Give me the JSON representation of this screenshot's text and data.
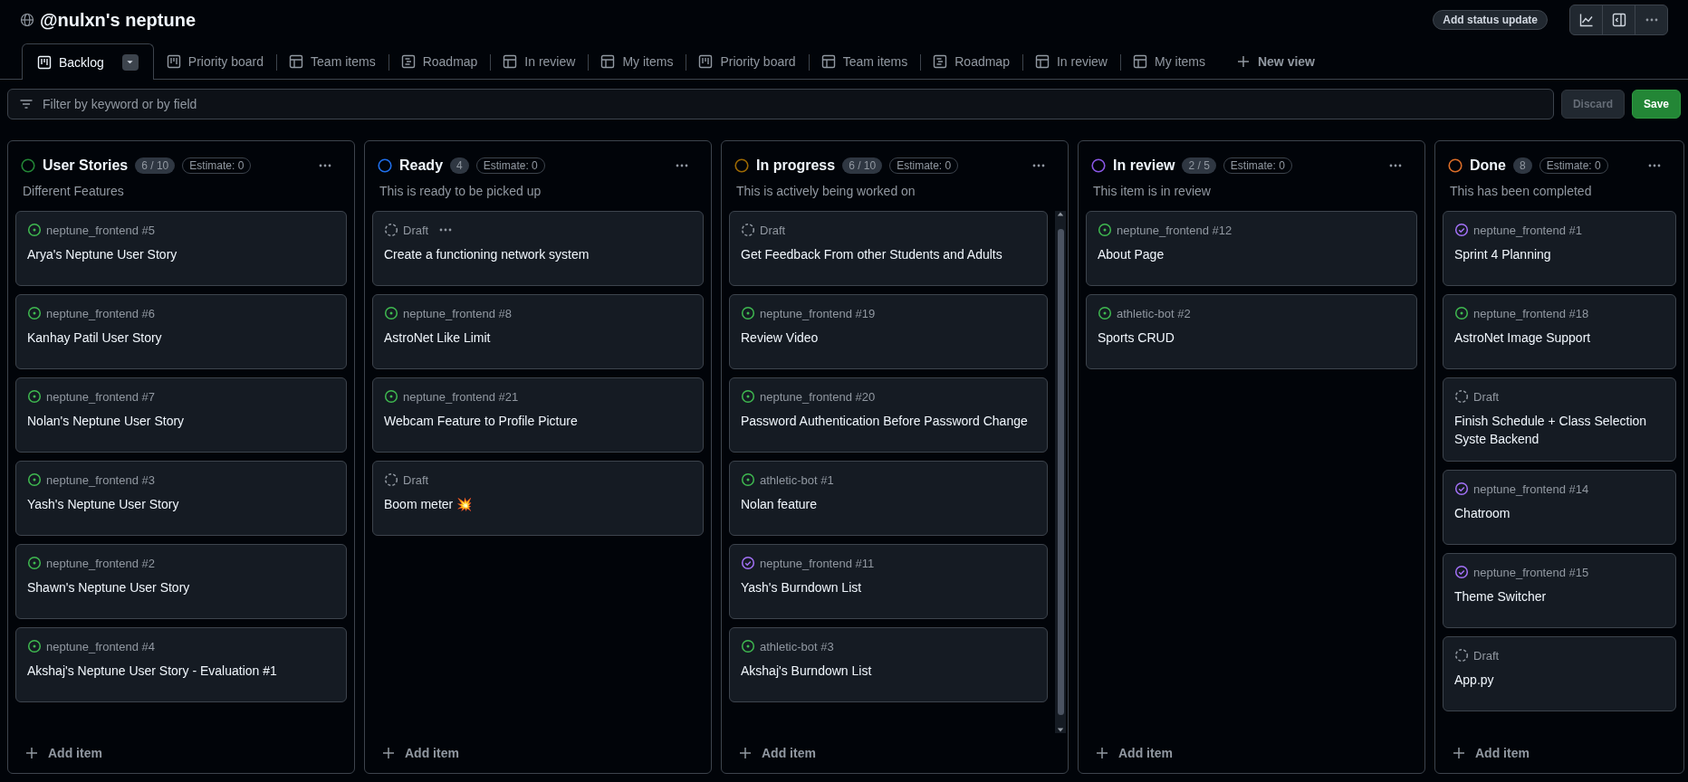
{
  "project": {
    "title": "@nulxn's neptune",
    "status_button": "Add status update"
  },
  "views": [
    {
      "label": "Backlog",
      "kind": "board",
      "selected": true
    },
    {
      "label": "Priority board",
      "kind": "board",
      "selected": false
    },
    {
      "label": "Team items",
      "kind": "table",
      "selected": false
    },
    {
      "label": "Roadmap",
      "kind": "roadmap",
      "selected": false
    },
    {
      "label": "In review",
      "kind": "table",
      "selected": false
    },
    {
      "label": "My items",
      "kind": "table",
      "selected": false
    },
    {
      "label": "Priority board",
      "kind": "board",
      "selected": false
    },
    {
      "label": "Team items",
      "kind": "table",
      "selected": false
    },
    {
      "label": "Roadmap",
      "kind": "roadmap",
      "selected": false
    },
    {
      "label": "In review",
      "kind": "table",
      "selected": false
    },
    {
      "label": "My items",
      "kind": "table",
      "selected": false
    }
  ],
  "new_view": "New view",
  "filter": {
    "placeholder": "Filter by keyword or by field",
    "discard": {
      "label": "Discard",
      "disabled": true
    },
    "save": {
      "label": "Save",
      "disabled": false
    }
  },
  "columns": [
    {
      "name": "User Stories",
      "color": "#238636",
      "count": "6 / 10",
      "estimate": "Estimate: 0",
      "description": "Different Features",
      "scrollbar": false,
      "add_item": "Add item",
      "items": [
        {
          "kind": "open",
          "meta": "neptune_frontend #5",
          "title": "Arya's Neptune User Story",
          "menu": false
        },
        {
          "kind": "open",
          "meta": "neptune_frontend #6",
          "title": "Kanhay Patil User Story",
          "menu": false
        },
        {
          "kind": "open",
          "meta": "neptune_frontend #7",
          "title": "Nolan's Neptune User Story",
          "menu": false
        },
        {
          "kind": "open",
          "meta": "neptune_frontend #3",
          "title": "Yash's Neptune User Story",
          "menu": false
        },
        {
          "kind": "open",
          "meta": "neptune_frontend #2",
          "title": "Shawn's Neptune User Story",
          "menu": false
        },
        {
          "kind": "open",
          "meta": "neptune_frontend #4",
          "title": "Akshaj's Neptune User Story - Evaluation #1",
          "menu": false
        }
      ]
    },
    {
      "name": "Ready",
      "color": "#1f6feb",
      "count": "4",
      "estimate": "Estimate: 0",
      "description": "This is ready to be picked up",
      "scrollbar": false,
      "add_item": "Add item",
      "items": [
        {
          "kind": "draft",
          "meta": "Draft",
          "title": "Create a functioning network system",
          "menu": true
        },
        {
          "kind": "open",
          "meta": "neptune_frontend #8",
          "title": "AstroNet Like Limit",
          "menu": false
        },
        {
          "kind": "open",
          "meta": "neptune_frontend #21",
          "title": "Webcam Feature to Profile Picture",
          "menu": false
        },
        {
          "kind": "draft",
          "meta": "Draft",
          "title": "Boom meter 💥",
          "menu": false
        }
      ]
    },
    {
      "name": "In progress",
      "color": "#9e6a03",
      "count": "6 / 10",
      "estimate": "Estimate: 0",
      "description": "This is actively being worked on",
      "scrollbar": true,
      "add_item": "Add item",
      "items": [
        {
          "kind": "draft",
          "meta": "Draft",
          "title": "Get Feedback From other Students and Adults",
          "menu": false
        },
        {
          "kind": "open",
          "meta": "neptune_frontend #19",
          "title": "Review Video",
          "menu": false
        },
        {
          "kind": "open",
          "meta": "neptune_frontend #20",
          "title": "Password Authentication Before Password Change",
          "menu": false
        },
        {
          "kind": "open",
          "meta": "athletic-bot #1",
          "title": "Nolan feature",
          "menu": false
        },
        {
          "kind": "closed",
          "meta": "neptune_frontend #11",
          "title": "Yash's Burndown List",
          "menu": false
        },
        {
          "kind": "open",
          "meta": "athletic-bot #3",
          "title": "Akshaj's Burndown List",
          "menu": false
        }
      ]
    },
    {
      "name": "In review",
      "color": "#8957e5",
      "count": "2 / 5",
      "estimate": "Estimate: 0",
      "description": "This item is in review",
      "scrollbar": false,
      "add_item": "Add item",
      "items": [
        {
          "kind": "open",
          "meta": "neptune_frontend #12",
          "title": "About Page",
          "menu": false
        },
        {
          "kind": "open",
          "meta": "athletic-bot #2",
          "title": "Sports CRUD",
          "menu": false
        }
      ]
    },
    {
      "name": "Done",
      "color": "#db6d28",
      "count": "8",
      "estimate": "Estimate: 0",
      "description": "This has been completed",
      "scrollbar": false,
      "add_item": "Add item",
      "items": [
        {
          "kind": "closed",
          "meta": "neptune_frontend #1",
          "title": "Sprint 4 Planning",
          "menu": false
        },
        {
          "kind": "open",
          "meta": "neptune_frontend #18",
          "title": "AstroNet Image Support",
          "menu": false
        },
        {
          "kind": "draft",
          "meta": "Draft",
          "title": "Finish Schedule + Class Selection Syste Backend",
          "menu": false
        },
        {
          "kind": "closed",
          "meta": "neptune_frontend #14",
          "title": "Chatroom",
          "menu": false
        },
        {
          "kind": "closed",
          "meta": "neptune_frontend #15",
          "title": "Theme Switcher",
          "menu": false
        },
        {
          "kind": "draft",
          "meta": "Draft",
          "title": "App.py",
          "menu": false
        }
      ]
    }
  ]
}
